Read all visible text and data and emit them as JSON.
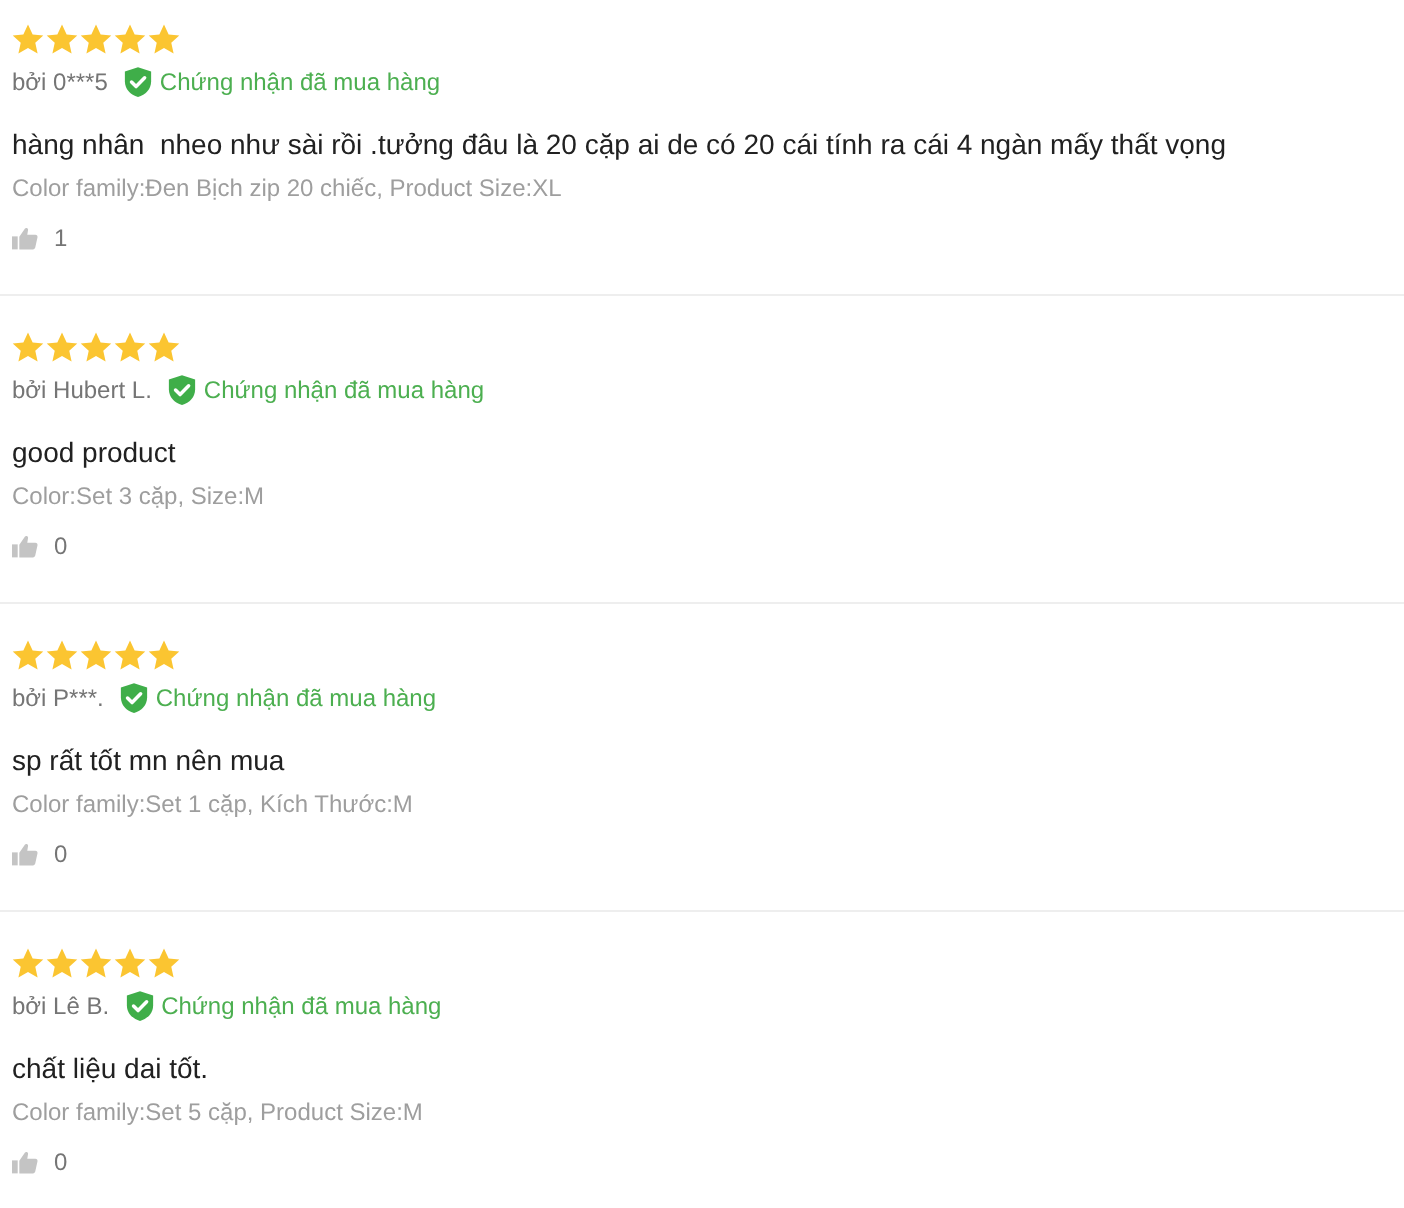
{
  "reviews": [
    {
      "stars": 5,
      "author": "bởi 0***5",
      "badge": "Chứng nhận đã mua hàng",
      "content": "hàng nhân  nheo như sài rồi .tưởng đâu là 20 cặp ai de có 20 cái tính ra cái 4 ngàn mấy thất vọng",
      "sku": "Color family:Đen Bịch zip 20 chiếc, Product Size:XL",
      "likes": "1"
    },
    {
      "stars": 5,
      "author": "bởi Hubert L.",
      "badge": "Chứng nhận đã mua hàng",
      "content": "good product",
      "sku": "Color:Set 3 cặp, Size:M",
      "likes": "0"
    },
    {
      "stars": 5,
      "author": "bởi P***.",
      "badge": "Chứng nhận đã mua hàng",
      "content": "sp rất tốt mn nên mua",
      "sku": "Color family:Set 1 cặp, Kích Thước:M",
      "likes": "0"
    },
    {
      "stars": 5,
      "author": "bởi Lê B.",
      "badge": "Chứng nhận đã mua hàng",
      "content": "chất liệu dai tốt.",
      "sku": "Color family:Set 5 cặp, Product Size:M",
      "likes": "0"
    }
  ]
}
